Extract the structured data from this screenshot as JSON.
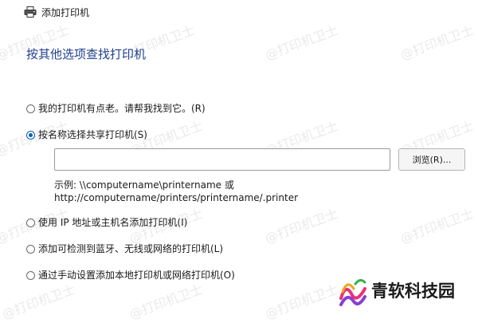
{
  "window": {
    "title": "添加打印机"
  },
  "heading": "按其他选项查找打印机",
  "options": [
    {
      "label": "我的打印机有点老。请帮我找到它。(R)",
      "checked": false
    },
    {
      "label": "按名称选择共享打印机(S)",
      "checked": true
    },
    {
      "label": "使用 IP 地址或主机名添加打印机(I)",
      "checked": false
    },
    {
      "label": "添加可检测到蓝牙、无线或网络的打印机(L)",
      "checked": false
    },
    {
      "label": "通过手动设置添加本地打印机或网络打印机(O)",
      "checked": false
    }
  ],
  "share_input": {
    "value": "",
    "placeholder": ""
  },
  "browse_button": "浏览(R)...",
  "example_line1": "示例: \\\\computername\\printername 或",
  "example_line2": "http://computername/printers/printername/.printer",
  "watermark_text": "@打印机卫士",
  "brand": {
    "text": "青软科技园"
  },
  "colors": {
    "heading": "#1f3f8f",
    "radio_accent": "#0f5fb7"
  }
}
